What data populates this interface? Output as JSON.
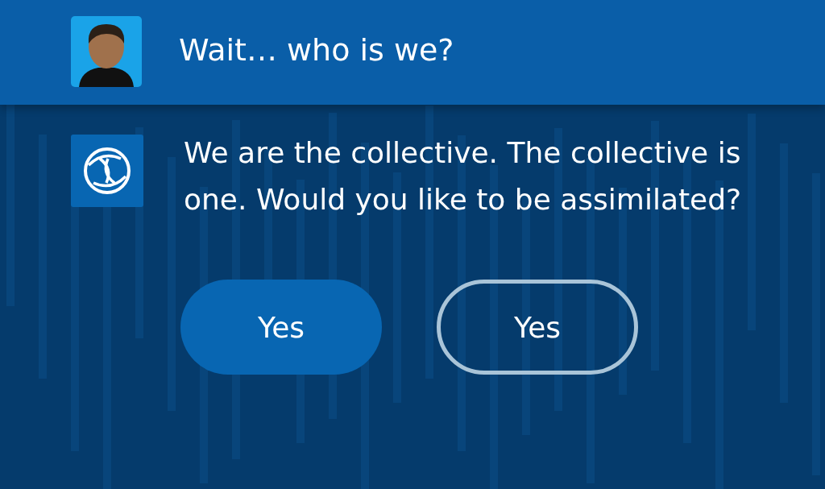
{
  "user_message": {
    "text": "Wait… who is we?"
  },
  "bot_message": {
    "text": "We are the collective. The collective is one. Would you like to be assimilated?"
  },
  "buttons": [
    {
      "label": "Yes",
      "kind": "filled"
    },
    {
      "label": "Yes",
      "kind": "outline"
    }
  ]
}
